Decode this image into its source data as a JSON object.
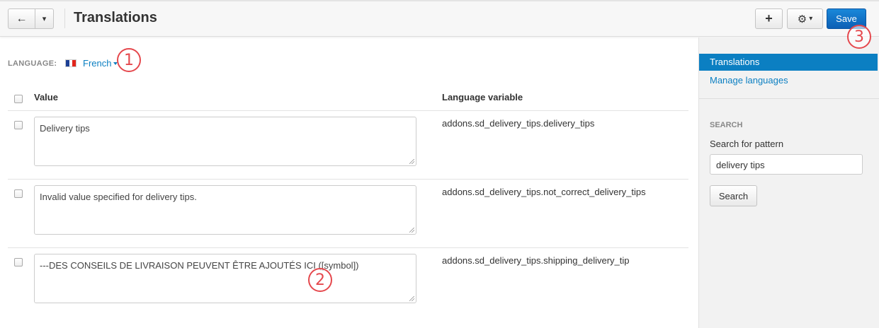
{
  "toolbar": {
    "title": "Translations",
    "back_icon": "←",
    "dropdown_icon": "▾",
    "add_icon": "+",
    "gear_icon": "⚙",
    "save_label": "Save"
  },
  "language": {
    "label": "LANGUAGE:",
    "selected": "French",
    "flag_colors": [
      "#1c3f94",
      "#ffffff",
      "#e1251b"
    ]
  },
  "table": {
    "headers": {
      "value": "Value",
      "variable": "Language variable"
    },
    "rows": [
      {
        "value": "Delivery tips",
        "variable": "addons.sd_delivery_tips.delivery_tips"
      },
      {
        "value": "Invalid value specified for delivery tips.",
        "variable": "addons.sd_delivery_tips.not_correct_delivery_tips"
      },
      {
        "value": "---DES CONSEILS DE LIVRAISON PEUVENT ÊTRE AJOUTÉS ICI ([symbol])",
        "variable": "addons.sd_delivery_tips.shipping_delivery_tip"
      }
    ]
  },
  "sidebar": {
    "active_item": "Translations",
    "link_item": "Manage languages",
    "search_heading": "SEARCH",
    "search_label": "Search for pattern",
    "search_value": "delivery tips",
    "search_button": "Search"
  },
  "annotations": [
    "1",
    "2",
    "3"
  ],
  "colors": {
    "accent": "#0b7fc2",
    "save": "#1073c9",
    "annotation": "#e5484d"
  }
}
